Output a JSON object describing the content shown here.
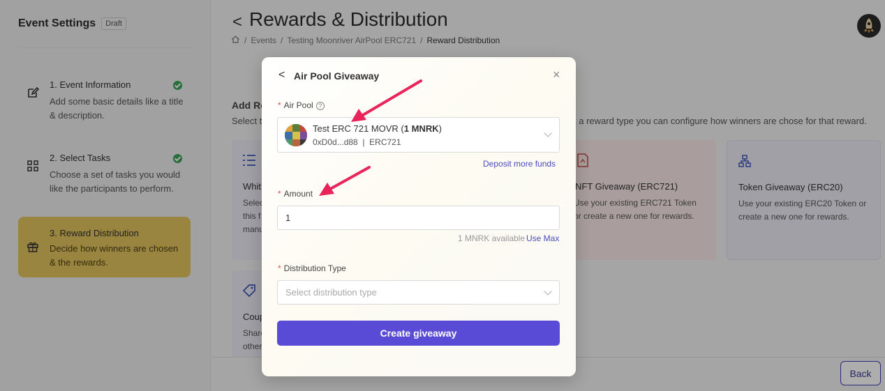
{
  "sidebar": {
    "title": "Event Settings",
    "badge": "Draft",
    "steps": [
      {
        "title": "1. Event Information",
        "desc": "Add some basic details like a title & description.",
        "done": true
      },
      {
        "title": "2. Select Tasks",
        "desc": "Choose a set of tasks you would like the participants to perform.",
        "done": true
      },
      {
        "title": "3. Reward Distribution",
        "desc": "Decide how winners are chosen & the rewards.",
        "done": false
      }
    ]
  },
  "header": {
    "back": "<",
    "title": "Rewards & Distribution",
    "breadcrumb": [
      "Events",
      "Testing Moonriver AirPool ERC721",
      "Reward Distribution"
    ],
    "separator": "/"
  },
  "section": {
    "title_visible": "Add Re",
    "desc_left": "Select th",
    "desc_right": "t a reward type you can configure how winners are chose for that reward."
  },
  "cards": [
    {
      "title": "Whit",
      "desc": "Selec\nthis f\nmanu",
      "icon": "list-icon"
    },
    {
      "title": "NFT Giveaway (ERC721)",
      "desc": "Use your existing ERC721 Token\nor create a new one for rewards.",
      "icon": "document-icon"
    },
    {
      "title": "Token Giveaway (ERC20)",
      "desc": "Use your existing ERC20 Token or\ncreate a new one for rewards.",
      "icon": "hierarchy-icon"
    },
    {
      "title": "Coup",
      "desc": "Share\nother",
      "icon": "tag-icon"
    }
  ],
  "footer": {
    "back_label": "Back"
  },
  "modal": {
    "back": "<",
    "title": "Air Pool Giveaway",
    "close": "×",
    "air_pool": {
      "label": "Air Pool",
      "required": "*",
      "name_prefix": "Test ERC 721 MOVR (",
      "name_bold": "1 MNRK",
      "name_suffix": ")",
      "address": "0xD0d...d88  |  ERC721"
    },
    "deposit_link": "Deposit more funds",
    "amount": {
      "label": "Amount",
      "required": "*",
      "value": "1",
      "available": "1 MNRK available",
      "use_max": "Use Max"
    },
    "distribution": {
      "label": "Distribution Type",
      "required": "*",
      "placeholder": "Select distribution type"
    },
    "submit_label": "Create giveaway"
  },
  "colors": {
    "accent": "#5a4bd6",
    "active_step": "#e2c55d",
    "check": "#3aa657",
    "arrow": "#e8245a"
  }
}
